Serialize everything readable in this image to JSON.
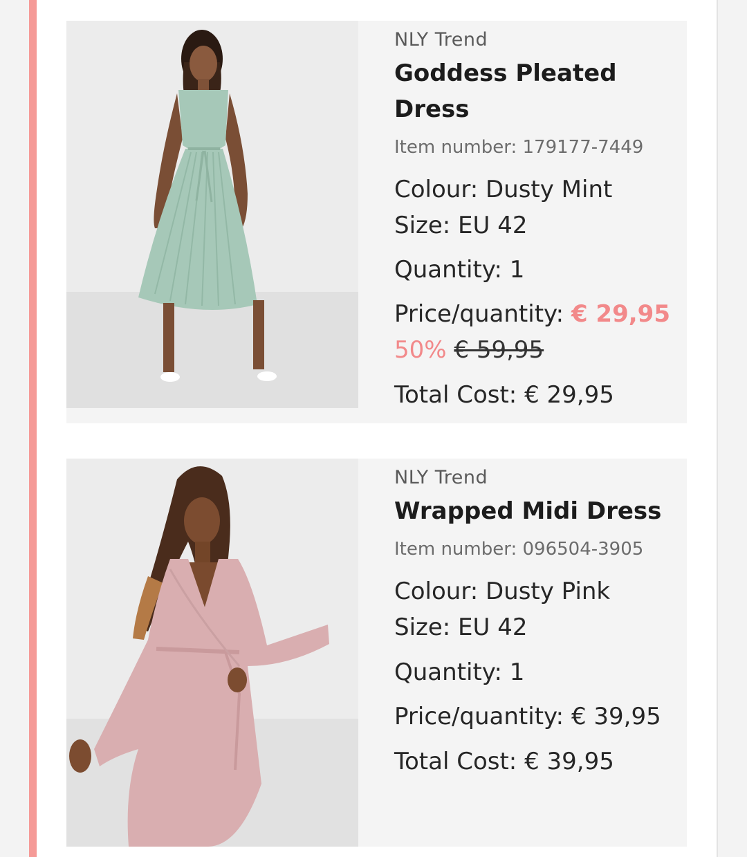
{
  "colors": {
    "accent": "#f59a97",
    "sale": "#f2898a",
    "card_bg": "#f4f4f4",
    "dress_mint": "#a6c8b8",
    "dress_pink": "#d9aeb0"
  },
  "items": [
    {
      "brand": "NLY Trend",
      "title": "Goddess Pleated Dress",
      "item_number": "Item number: 179177-7449",
      "colour": "Colour: Dusty Mint",
      "size": "Size: EU 42",
      "quantity": "Quantity: 1",
      "price_label": "Price/quantity:",
      "price": "€ 29,95",
      "discount": "50%",
      "original_price": "€ 59,95",
      "total": "Total Cost: € 29,95",
      "image_icon": "dress-photo"
    },
    {
      "brand": "NLY Trend",
      "title": "Wrapped Midi Dress",
      "item_number": "Item number: 096504-3905",
      "colour": "Colour: Dusty Pink",
      "size": "Size: EU 42",
      "quantity": "Quantity: 1",
      "price_label": "Price/quantity:",
      "price": "€ 39,95",
      "total": "Total Cost: € 39,95",
      "image_icon": "dress-photo"
    }
  ]
}
